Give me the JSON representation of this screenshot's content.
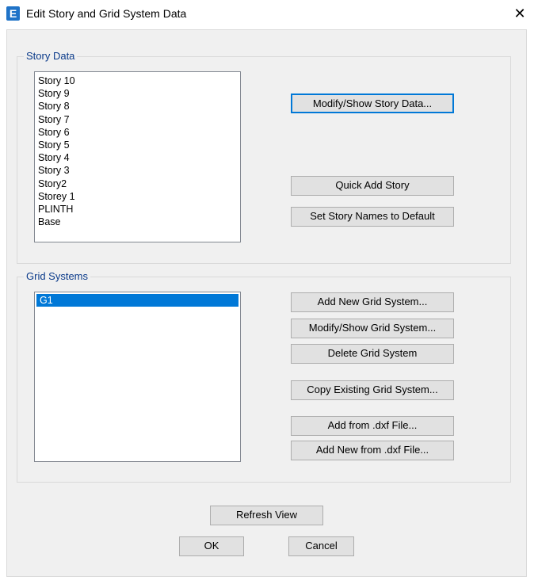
{
  "window": {
    "title": "Edit Story and Grid System Data",
    "app_icon_letter": "E",
    "close_glyph": "✕"
  },
  "story_data": {
    "group_label": "Story Data",
    "stories": [
      "Story 10",
      "Story 9",
      "Story 8",
      "Story 7",
      "Story 6",
      "Story 5",
      "Story 4",
      "Story 3",
      "Story2",
      "Storey 1",
      "PLINTH",
      "Base"
    ],
    "modify_show_label": "Modify/Show Story Data...",
    "quick_add_label": "Quick Add Story",
    "set_names_default_label": "Set Story Names to Default"
  },
  "grid_systems": {
    "group_label": "Grid Systems",
    "items": [
      "G1"
    ],
    "selected": "G1",
    "add_new_label": "Add New Grid System...",
    "modify_show_label": "Modify/Show Grid System...",
    "delete_label": "Delete Grid System",
    "copy_existing_label": "Copy Existing Grid System...",
    "add_from_dxf_label": "Add  from .dxf File...",
    "add_new_from_dxf_label": "Add New from .dxf File..."
  },
  "footer": {
    "refresh_label": "Refresh View",
    "ok_label": "OK",
    "cancel_label": "Cancel"
  },
  "colors": {
    "accent": "#0078d7",
    "group_label": "#0a3a8a"
  }
}
